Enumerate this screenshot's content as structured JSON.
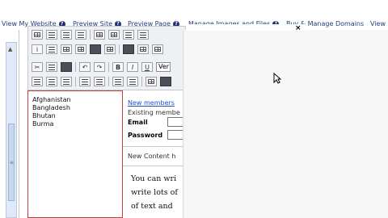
{
  "topnav": {
    "items": [
      {
        "label": "View My Website"
      },
      {
        "label": "Preview Site"
      },
      {
        "label": "Preview Page"
      },
      {
        "label": "Manage Images and Files"
      },
      {
        "label": "Buy & Manage Domains"
      },
      {
        "label": "View"
      }
    ],
    "help_glyph": "?"
  },
  "toolbar": {
    "font_select_value": "Ver",
    "bold_label": "B",
    "italic_label": "I",
    "underline_label": "U",
    "undo_glyph": "↶",
    "redo_glyph": "↷",
    "info_glyph": "i"
  },
  "editor": {
    "countries": [
      "Afghanistan",
      "Bangladesh",
      "Bhutan",
      "Burma"
    ],
    "new_members_link": "New members",
    "existing_members_text": "Existing membe",
    "email_label": "Email",
    "password_label": "Password",
    "new_content_text": "New Content h",
    "handwritten_lines": [
      "You can wri",
      "write lots of",
      "of text and"
    ]
  },
  "modal": {
    "close_glyph": "×"
  },
  "icons": {
    "scroll_arrow": "up-arrow-icon",
    "cursor": "mouse-pointer-icon"
  }
}
